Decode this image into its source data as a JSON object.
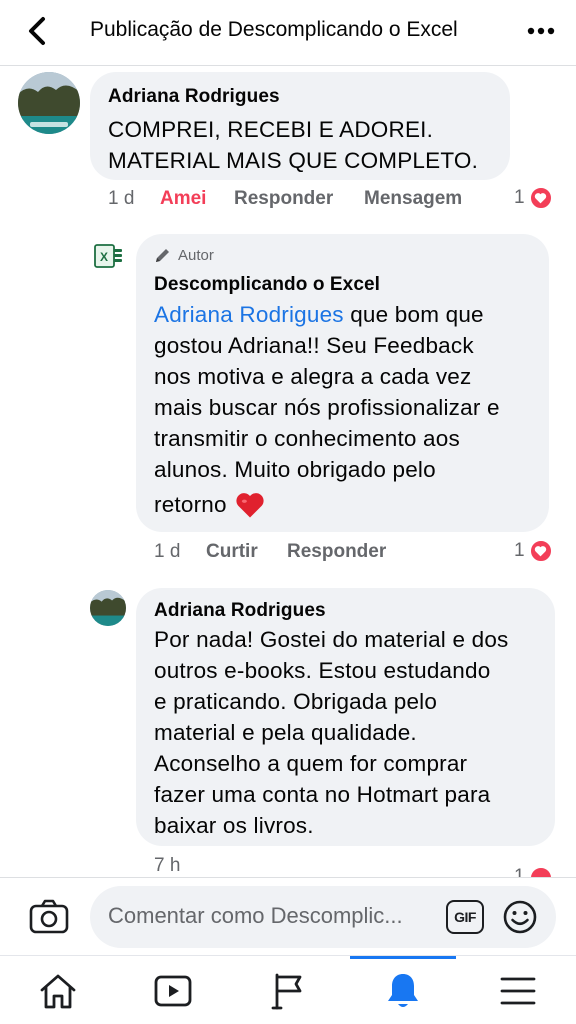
{
  "header": {
    "title": "Publicação de Descomplicando o Excel"
  },
  "comments": [
    {
      "author": "Adriana Rodrigues",
      "text_lines": [
        "COMPREI, RECEBI E ADOREI.",
        "MATERIAL MAIS QUE COMPLETO."
      ],
      "time": "1 d",
      "reaction_label": "Amei",
      "reply_label": "Responder",
      "message_label": "Mensagem",
      "reaction_count": "1"
    },
    {
      "badge": "Autor",
      "author": "Descomplicando o Excel",
      "mention": "Adriana Rodrigues",
      "text_lines": [
        " que bom que",
        "gostou Adriana!! Seu Feedback",
        "nos motiva e alegra a cada vez",
        "mais buscar nós profissionalizar e",
        "transmitir o conhecimento aos",
        "alunos. Muito obrigado pelo",
        "retorno"
      ],
      "time": "1 d",
      "like_label": "Curtir",
      "reply_label": "Responder",
      "reaction_count": "1"
    },
    {
      "author": "Adriana Rodrigues",
      "text_lines": [
        "Por nada! Gostei do material e dos",
        "outros e-books. Estou estudando",
        "e praticando. Obrigada pelo",
        "material e pela qualidade.",
        "Aconselho a quem for comprar",
        "fazer uma conta no Hotmart para",
        "baixar os livros."
      ],
      "time": "7 h",
      "reaction_count": "1"
    }
  ],
  "composer": {
    "placeholder": "Comentar como Descomplic..."
  },
  "tabs": [
    "home-icon",
    "video-icon",
    "pages-flag-icon",
    "notifications-bell-icon",
    "menu-icon"
  ],
  "colors": {
    "accent": "#1877f2",
    "bubble": "#f0f2f5",
    "love": "#f33e58",
    "mention": "#1b74e4",
    "secondary_text": "#65676b"
  }
}
